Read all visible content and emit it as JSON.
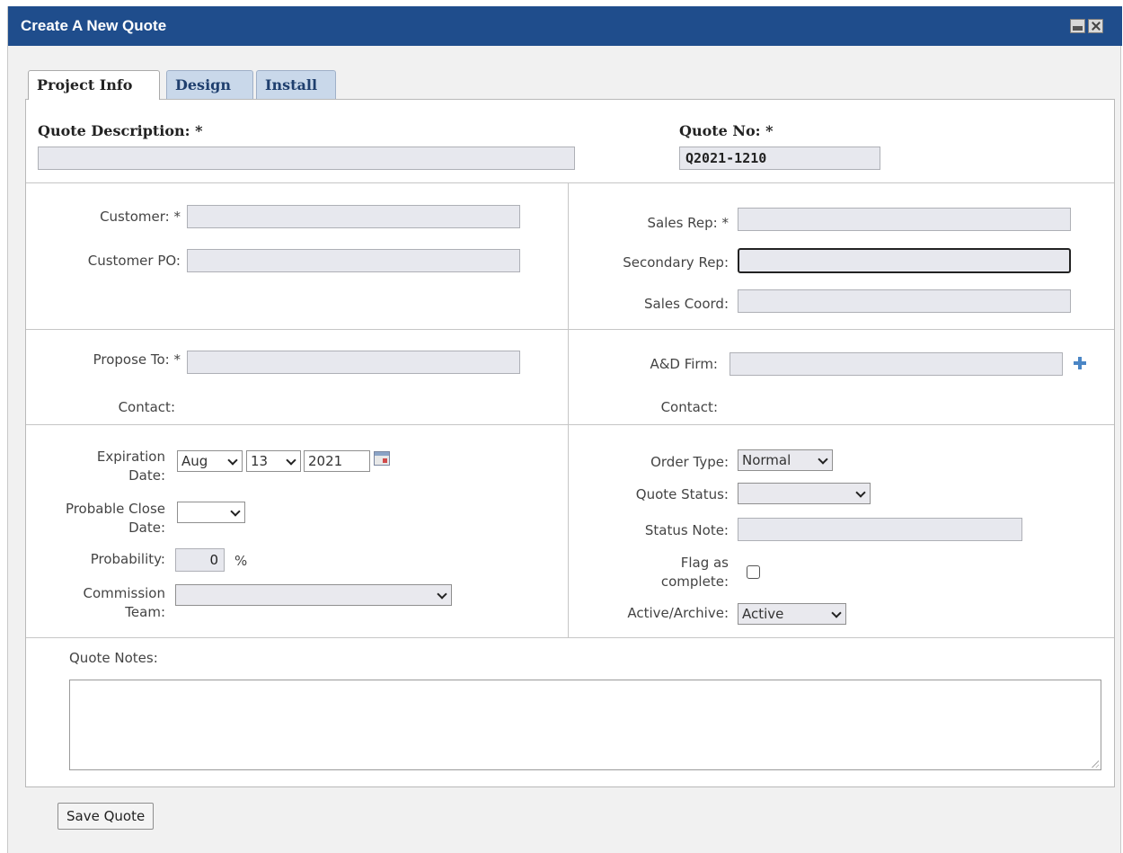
{
  "window": {
    "title": "Create A New Quote"
  },
  "tabs": [
    "Project Info",
    "Design",
    "Install"
  ],
  "header": {
    "quote_description_label": "Quote Description: *",
    "quote_description_value": "",
    "quote_no_label": "Quote No: *",
    "quote_no_value": "Q2021-1210"
  },
  "section_customer": {
    "customer_label": "Customer: *",
    "customer_value": "",
    "customer_po_label": "Customer PO:",
    "customer_po_value": "",
    "sales_rep_label": "Sales Rep: *",
    "secondary_rep_label": "Secondary Rep:",
    "sales_coord_label": "Sales Coord:"
  },
  "section_propose": {
    "propose_to_label": "Propose To: *",
    "contact_label": "Contact:",
    "ad_firm_label": "A&D Firm:",
    "ad_contact_label": "Contact:"
  },
  "section_dates": {
    "expiration_label_1": "Expiration",
    "expiration_label_2": "Date:",
    "exp_month": "Aug",
    "exp_day": "13",
    "exp_year": "2021",
    "probable_close_label_1": "Probable Close",
    "probable_close_label_2": "Date:",
    "probable_close_value": "",
    "probability_label": "Probability:",
    "probability_value": "0",
    "probability_unit": "%",
    "commission_label_1": "Commission",
    "commission_label_2": "Team:",
    "commission_value": "",
    "order_type_label": "Order Type:",
    "order_type_value": "Normal",
    "quote_status_label": "Quote Status:",
    "quote_status_value": "",
    "status_note_label": "Status Note:",
    "flag_label_1": "Flag as",
    "flag_label_2": "complete:",
    "flag_checked": false,
    "active_archive_label": "Active/Archive:",
    "active_archive_value": "Active"
  },
  "notes": {
    "label": "Quote Notes:",
    "value": ""
  },
  "footer": {
    "save_label": "Save Quote"
  },
  "icons": {
    "calendar": "calendar-icon",
    "add": "plus-icon",
    "dropdown": "chevron-down-icon",
    "minimize": "minimize-icon",
    "close": "close-icon"
  },
  "colors": {
    "titlebar": "#1f4d8c",
    "tab_inactive": "#c9d8ea",
    "field_bg": "#e7e8ee"
  }
}
